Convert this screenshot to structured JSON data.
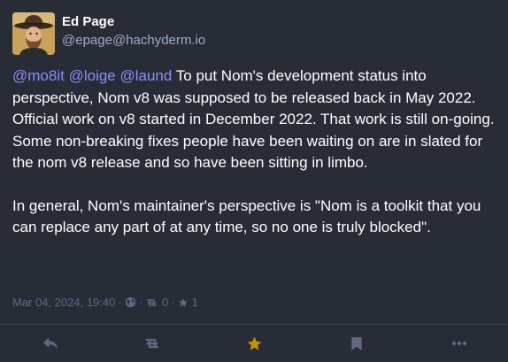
{
  "author": {
    "display_name": "Ed Page",
    "handle": "@epage@hachyderm.io"
  },
  "post": {
    "mentions": [
      "@mo8it",
      "@loige",
      "@laund"
    ],
    "paragraph_1_text": " To put Nom's development status into perspective, Nom v8 was supposed to be released back in May 2022.  Official work on v8 started in December 2022.  That work is still on-going.  Some non-breaking fixes people have been waiting on are in slated for the nom v8 release and so have been sitting in limbo.",
    "paragraph_2_text": "In general, Nom's maintainer's perspective is \"Nom is a toolkit that you can replace any part of at any time, so no one is truly blocked\"."
  },
  "meta": {
    "timestamp": "Mar 04, 2024, 19:40",
    "separator": "·",
    "visibility_icon": "globe-icon",
    "boost_icon": "retweet-icon",
    "boost_count": "0",
    "favourite_icon": "star-icon",
    "favourite_count": "1"
  },
  "actions": [
    {
      "name": "reply",
      "icon": "reply-icon"
    },
    {
      "name": "boost",
      "icon": "retweet-icon"
    },
    {
      "name": "favourite",
      "icon": "star-icon",
      "active": true
    },
    {
      "name": "bookmark",
      "icon": "bookmark-icon"
    },
    {
      "name": "more",
      "icon": "ellipsis-icon"
    }
  ],
  "colors": {
    "background": "#282c37",
    "mention": "#8c8dff",
    "meta_text": "#606984",
    "action_icon": "#606984",
    "favourite_active": "#ca8f04",
    "handle": "#9baec8"
  }
}
